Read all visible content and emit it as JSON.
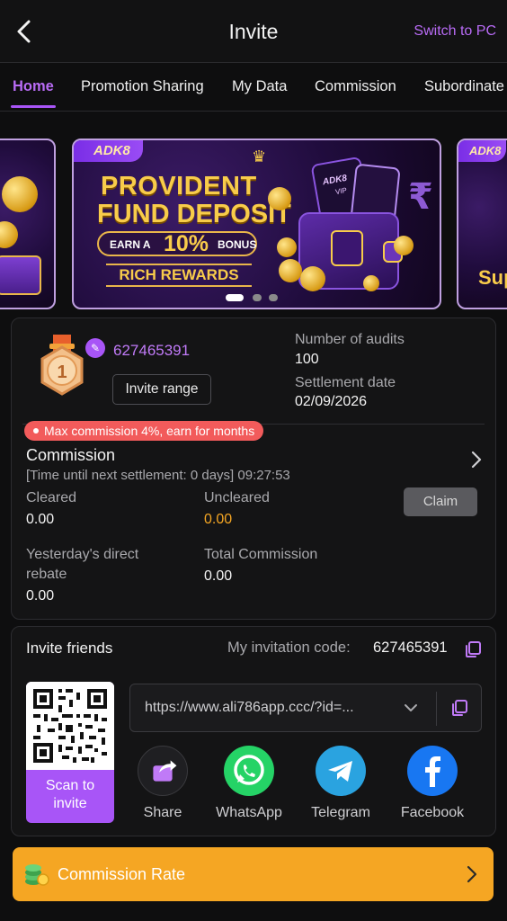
{
  "header": {
    "title": "Invite",
    "switch_label": "Switch to PC"
  },
  "tabs": [
    {
      "label": "Home",
      "active": true
    },
    {
      "label": "Promotion Sharing",
      "active": false
    },
    {
      "label": "My Data",
      "active": false
    },
    {
      "label": "Commission",
      "active": false
    },
    {
      "label": "Subordinate",
      "active": false
    }
  ],
  "banner": {
    "brand": "ADK8",
    "line1": "PROVIDENT",
    "line2": "FUND DEPOSIT",
    "earn": "EARN A",
    "percent": "10%",
    "bonus": "BONUS",
    "rich": "RICH REWARDS",
    "card_text": "ADK8",
    "card_sub": "VIP",
    "right_text": "Sup",
    "active_dot": 0,
    "dot_count": 3
  },
  "profile": {
    "user_id": "627465391",
    "medal_rank": "1",
    "invite_range_label": "Invite range",
    "audits_label": "Number of audits",
    "audits_value": "100",
    "settlement_label": "Settlement date",
    "settlement_value": "02/09/2026"
  },
  "commission": {
    "badge": "Max commission 4%, earn for months",
    "title": "Commission",
    "subtitle": "[Time until next settlement: 0 days] 09:27:53",
    "cleared_label": "Cleared",
    "cleared_value": "0.00",
    "uncleared_label": "Uncleared",
    "uncleared_value": "0.00",
    "claim_label": "Claim",
    "yesterday_label_1": "Yesterday's direct",
    "yesterday_label_2": "rebate",
    "yesterday_value": "0.00",
    "total_label": "Total Commission",
    "total_value": "0.00"
  },
  "invite": {
    "title": "Invite friends",
    "code_label": "My invitation code:",
    "code_value": "627465391",
    "qr_label_1": "Scan to",
    "qr_label_2": "invite",
    "link": "https://www.ali786app.ccc/?id=...",
    "share_options": [
      {
        "label": "Share",
        "icon": "share-icon",
        "color": "#1f1f22"
      },
      {
        "label": "WhatsApp",
        "icon": "whatsapp-icon",
        "color": "#25d366"
      },
      {
        "label": "Telegram",
        "icon": "telegram-icon",
        "color": "#2aa3e0"
      },
      {
        "label": "Facebook",
        "icon": "facebook-icon",
        "color": "#1877f2"
      }
    ]
  },
  "rate_bar": {
    "label": "Commission Rate",
    "color": "#f5a623"
  },
  "colors": {
    "accent": "#a855f7",
    "accent_text": "#b86bf5",
    "orange": "#f5a623",
    "badge_red": "#f25b5b"
  }
}
